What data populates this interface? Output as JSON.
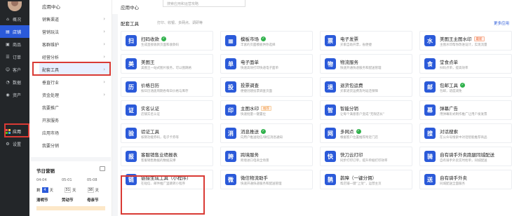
{
  "sidebar": {
    "items": [
      {
        "label": "概况",
        "icon": "home-icon"
      },
      {
        "label": "店铺",
        "icon": "store-icon"
      },
      {
        "label": "商品",
        "icon": "goods-icon"
      },
      {
        "label": "订单",
        "icon": "order-icon"
      },
      {
        "label": "客户",
        "icon": "customer-icon"
      },
      {
        "label": "数据",
        "icon": "data-icon"
      },
      {
        "label": "资产",
        "icon": "asset-icon"
      },
      {
        "label": "应用",
        "icon": "apps-icon"
      },
      {
        "label": "设置",
        "icon": "settings-icon"
      }
    ]
  },
  "menu": {
    "title": "应用中心",
    "items": [
      {
        "label": "销售渠道",
        "arrow": "›"
      },
      {
        "label": "营销玩法",
        "arrow": "›"
      },
      {
        "label": "客群维护",
        "arrow": "›"
      },
      {
        "label": "经营分析",
        "arrow": "›"
      },
      {
        "label": "配套工具",
        "arrow": "›"
      },
      {
        "label": "垂直行业",
        "arrow": "›"
      },
      {
        "label": "资金处理",
        "arrow": "›"
      },
      {
        "label": "我要推广",
        "arrow": ""
      },
      {
        "label": "开放服务",
        "arrow": ""
      },
      {
        "label": "应用市场",
        "arrow": ""
      },
      {
        "label": "我要分销",
        "arrow": ""
      }
    ]
  },
  "calendar": {
    "title": "节日营销",
    "dates": [
      "04-04",
      "05-01",
      "05-08"
    ],
    "countdown": {
      "prefix": "剩",
      "d1": "4",
      "u1": "天",
      "d2": "31",
      "u2": "天",
      "d3": "38",
      "u3": "天"
    },
    "festivals": [
      "清明节",
      "劳动节",
      "母亲节"
    ]
  },
  "header": {
    "title": "应用中心",
    "search_placeholder": "搜索应用和运营攻略"
  },
  "panel": {
    "title": "配套工具",
    "tags": "打印、收银、多网点、调研等",
    "more": "更多应用",
    "cards": [
      {
        "title": "扫码收款",
        "desc": "生成直接收款页面和收款码",
        "icon": "扫",
        "badge": "check"
      },
      {
        "title": "模板市场",
        "desc": "丰富的页面模板供你选择",
        "icon": "▦",
        "badge": "check"
      },
      {
        "title": "电子发票",
        "desc": "买家自助开票，省便捷",
        "icon": "票",
        "badge": ""
      },
      {
        "title": "美图王主图水印",
        "desc": "主图水印帮你改进设计，实现流量",
        "icon": "水",
        "badge": "最新"
      },
      {
        "title": "美图王",
        "desc": "美图王一站式图片服务，可以图跳格",
        "icon": "美",
        "badge": ""
      },
      {
        "title": "电子面单",
        "desc": "快速高效打印快递电子面单",
        "icon": "单",
        "badge": ""
      },
      {
        "title": "物流服务",
        "desc": "快速开通快递服务和配送管理",
        "icon": "物",
        "badge": ""
      },
      {
        "title": "堂食点单",
        "desc": "扫码点单，提高效率",
        "icon": "食",
        "badge": ""
      },
      {
        "title": "价格日历",
        "desc": "按日历涵盖周期各每日价格与库存",
        "icon": "历",
        "badge": ""
      },
      {
        "title": "投票调查",
        "desc": "便捷创建投票调查页面",
        "icon": "投",
        "badge": ""
      },
      {
        "title": "退货包运费",
        "desc": "买家退货运费及时返还保障",
        "icon": "退",
        "badge": ""
      },
      {
        "title": "包邮工具",
        "desc": "包邮，适度减免",
        "icon": "邮",
        "badge": "check"
      },
      {
        "title": "实名认证",
        "desc": "店铺实名认证",
        "icon": "证",
        "badge": ""
      },
      {
        "title": "主图水印",
        "desc": "快速批量一键置位",
        "icon": "印",
        "badge": "推荐"
      },
      {
        "title": "智能分销",
        "desc": "让每个满意客户变成“无限店长”",
        "icon": "智",
        "badge": ""
      },
      {
        "title": "弹幕广告",
        "desc": "用弹幕形式制作推广让用户发发票",
        "icon": "幕",
        "badge": ""
      },
      {
        "title": "验证工具",
        "desc": "核销功能券码，电子卡券等",
        "icon": "验",
        "badge": ""
      },
      {
        "title": "消息推送",
        "desc": "向用户推送短信/微信消息通知",
        "icon": "消",
        "badge": "check"
      },
      {
        "title": "多网点",
        "desc": "根据客户位置推荐附近门店",
        "icon": "网",
        "badge": "check"
      },
      {
        "title": "对话搜索",
        "desc": "在公众号搜索中对话智能推荐商品",
        "icon": "搜",
        "badge": ""
      },
      {
        "title": "客服销售业绩报表",
        "desc": "客服销售数据的数据支撑",
        "icon": "报",
        "badge": ""
      },
      {
        "title": "跨境服务",
        "desc": "跨境进口电商全场景",
        "icon": "跨",
        "badge": ""
      },
      {
        "title": "快刀云打印",
        "desc": "同步打印订单，提升单据打印效率",
        "icon": "快",
        "badge": ""
      },
      {
        "title": "自有骑手外卖跑腿同城配送",
        "desc": "自有骑手外卖实时抢单，同城配送",
        "icon": "骑",
        "badge": ""
      },
      {
        "title": "链接生成工具（小程序）",
        "desc": "在短信、邮件推广里跳转小程序",
        "icon": "链",
        "badge": ""
      },
      {
        "title": "微信物流助手",
        "desc": "快速开通快递服务和配送管理",
        "icon": "微",
        "badge": ""
      },
      {
        "title": "鹊障（一键分佣）",
        "desc": "帮店铺一键“上架”，运营主页",
        "icon": "鹊",
        "badge": ""
      },
      {
        "title": "自有骑手外卖",
        "desc": "同城配送全面服务",
        "icon": "送",
        "badge": ""
      }
    ]
  },
  "colors": {
    "accent": "#2b5ad9",
    "highlight": "#d93a34",
    "sidebar_bg": "#232629"
  }
}
